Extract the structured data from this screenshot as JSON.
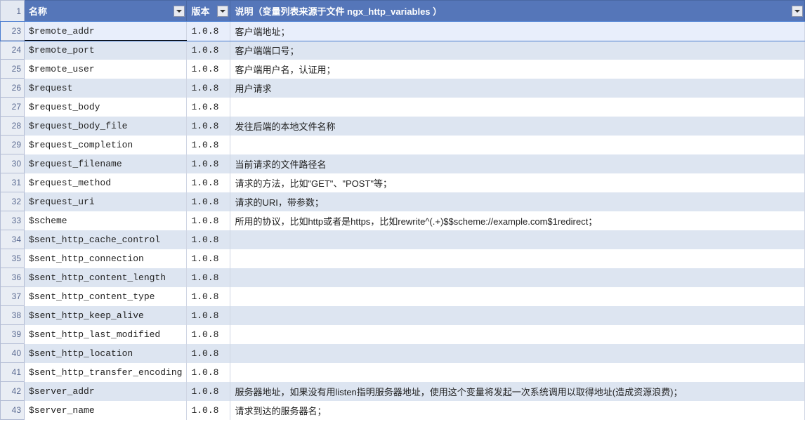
{
  "header": {
    "rowNum": "1",
    "cols": {
      "name": "名称",
      "version": "版本",
      "desc": "说明（变量列表来源于文件 ngx_http_variables ）"
    }
  },
  "rows": [
    {
      "num": "23",
      "name": "$remote_addr",
      "ver": "1.0.8",
      "desc": "客户端地址；",
      "selected": true
    },
    {
      "num": "24",
      "name": "$remote_port",
      "ver": "1.0.8",
      "desc": "客户端端口号；"
    },
    {
      "num": "25",
      "name": "$remote_user",
      "ver": "1.0.8",
      "desc": "客户端用户名，认证用；"
    },
    {
      "num": "26",
      "name": "$request",
      "ver": "1.0.8",
      "desc": "用户请求"
    },
    {
      "num": "27",
      "name": "$request_body",
      "ver": "1.0.8",
      "desc": ""
    },
    {
      "num": "28",
      "name": "$request_body_file",
      "ver": "1.0.8",
      "desc": "发往后端的本地文件名称"
    },
    {
      "num": "29",
      "name": "$request_completion",
      "ver": "1.0.8",
      "desc": ""
    },
    {
      "num": "30",
      "name": "$request_filename",
      "ver": "1.0.8",
      "desc": "当前请求的文件路径名"
    },
    {
      "num": "31",
      "name": "$request_method",
      "ver": "1.0.8",
      "desc": "请求的方法，比如\"GET\"、\"POST\"等；"
    },
    {
      "num": "32",
      "name": "$request_uri",
      "ver": "1.0.8",
      "desc": "请求的URI，带参数；"
    },
    {
      "num": "33",
      "name": "$scheme",
      "ver": "1.0.8",
      "desc": "所用的协议，比如http或者是https，比如rewrite^(.+)$$scheme://example.com$1redirect；"
    },
    {
      "num": "34",
      "name": "$sent_http_cache_control",
      "ver": "1.0.8",
      "desc": ""
    },
    {
      "num": "35",
      "name": "$sent_http_connection",
      "ver": "1.0.8",
      "desc": ""
    },
    {
      "num": "36",
      "name": "$sent_http_content_length",
      "ver": "1.0.8",
      "desc": ""
    },
    {
      "num": "37",
      "name": "$sent_http_content_type",
      "ver": "1.0.8",
      "desc": ""
    },
    {
      "num": "38",
      "name": "$sent_http_keep_alive",
      "ver": "1.0.8",
      "desc": ""
    },
    {
      "num": "39",
      "name": "$sent_http_last_modified",
      "ver": "1.0.8",
      "desc": ""
    },
    {
      "num": "40",
      "name": "$sent_http_location",
      "ver": "1.0.8",
      "desc": ""
    },
    {
      "num": "41",
      "name": "$sent_http_transfer_encoding",
      "ver": "1.0.8",
      "desc": ""
    },
    {
      "num": "42",
      "name": "$server_addr",
      "ver": "1.0.8",
      "desc": "服务器地址，如果没有用listen指明服务器地址，使用这个变量将发起一次系统调用以取得地址(造成资源浪费)；"
    },
    {
      "num": "43",
      "name": "$server_name",
      "ver": "1.0.8",
      "desc": "请求到达的服务器名；"
    }
  ]
}
